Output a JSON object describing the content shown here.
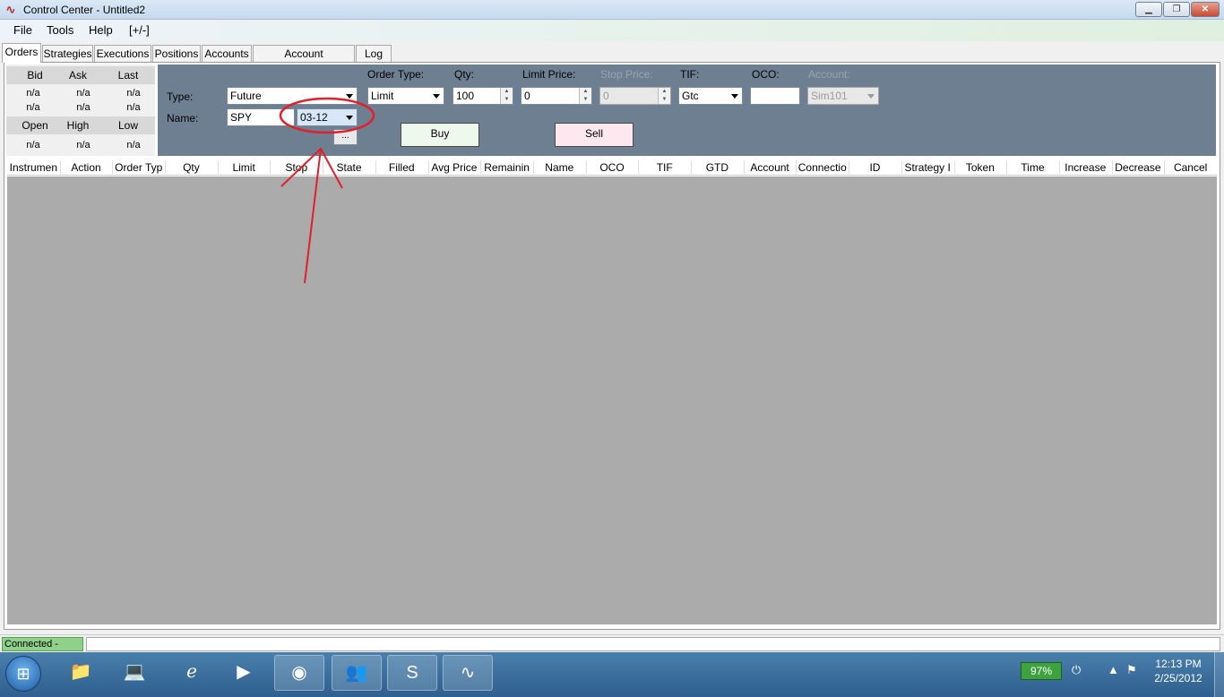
{
  "window": {
    "title": "Control Center - Untitled2"
  },
  "menu": [
    "File",
    "Tools",
    "Help",
    "[+/-]"
  ],
  "tabs": [
    "Orders",
    "Strategies",
    "Executions",
    "Positions",
    "Accounts",
    "Account Performance",
    "Log"
  ],
  "quote": {
    "headers_top": [
      "Bid",
      "Ask",
      "Last"
    ],
    "values_row1": [
      "n/a",
      "n/a",
      "n/a"
    ],
    "values_row2": [
      "n/a",
      "n/a",
      "n/a"
    ],
    "headers_bottom": [
      "Open",
      "High",
      "Low"
    ],
    "values_row3": [
      "n/a",
      "n/a",
      "n/a"
    ]
  },
  "entry": {
    "type_label": "Type:",
    "type_value": "Future",
    "name_label": "Name:",
    "name_value": "SPY",
    "expiry_value": "03-12",
    "browse_label": "...",
    "order_type_label": "Order Type:",
    "order_type_value": "Limit",
    "qty_label": "Qty:",
    "qty_value": "100",
    "limit_label": "Limit Price:",
    "limit_value": "0",
    "stop_label": "Stop Price:",
    "stop_value": "0",
    "tif_label": "TIF:",
    "tif_value": "Gtc",
    "oco_label": "OCO:",
    "oco_value": "",
    "account_label": "Account:",
    "account_value": "Sim101",
    "buy_label": "Buy",
    "sell_label": "Sell",
    "buy_color": "#ecf9ec",
    "sell_color": "#fce8ee"
  },
  "grid_columns": [
    "Instrumen",
    "Action",
    "Order Typ",
    "Qty",
    "Limit",
    "Stop",
    "State",
    "Filled",
    "Avg Price",
    "Remainin",
    "Name",
    "OCO",
    "TIF",
    "GTD",
    "Account",
    "Connectio",
    "ID",
    "Strategy I",
    "Token",
    "Time",
    "Increase",
    "Decrease",
    "Cancel"
  ],
  "status": {
    "connection": "Connected - CQG",
    "connection_color": "#8fd08a"
  },
  "taskbar": {
    "apps": [
      "explorer-icon",
      "laptop-icon",
      "internet-explorer-icon",
      "media-player-icon",
      "chrome-icon",
      "messenger-icon",
      "skype-icon",
      "ninjatrader-icon"
    ],
    "battery": "97%",
    "time": "12:13 PM",
    "date": "2/25/2012"
  },
  "annotation_color": "#e0202a"
}
